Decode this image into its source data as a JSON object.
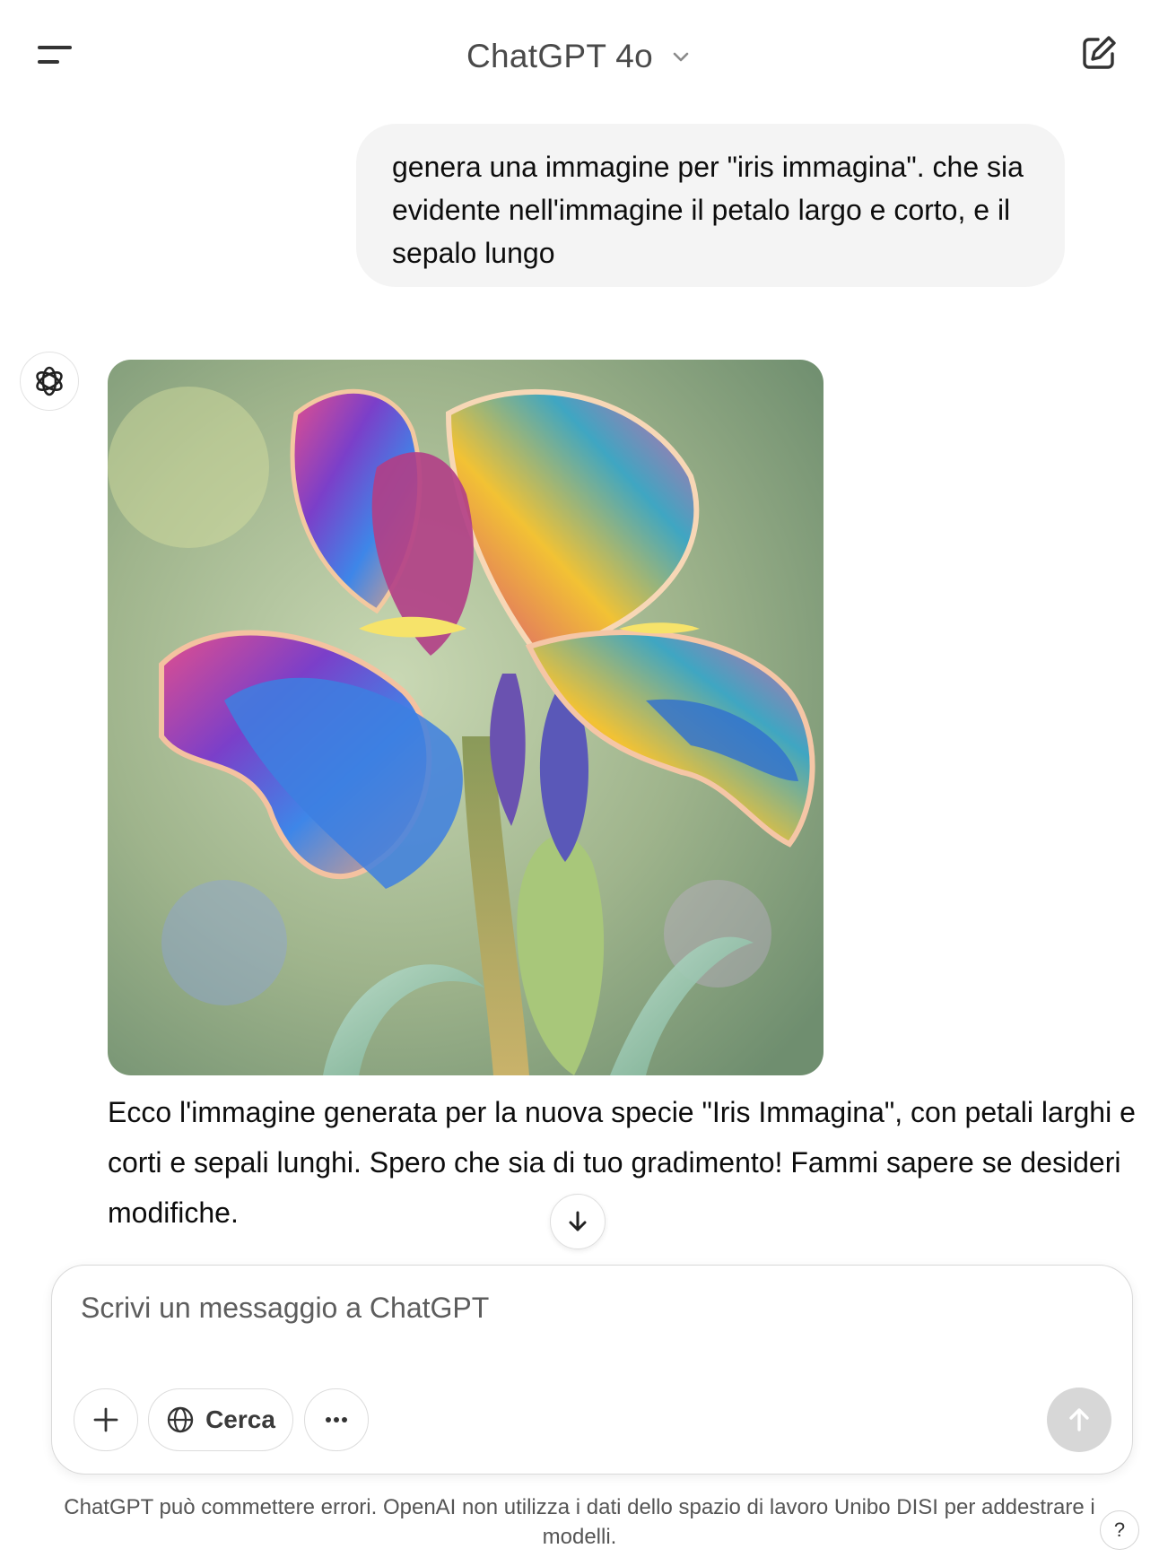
{
  "header": {
    "title": "ChatGPT 4o",
    "menu_icon": "sidebar-menu-icon",
    "compose_icon": "new-chat-compose-icon"
  },
  "conversation": {
    "user_message": "genera una immagine per \"iris immagina\". che sia evidente nell'immagine il petalo largo e corto, e il sepalo lungo",
    "assistant_avatar_icon": "openai-logo-icon",
    "assistant_image_icon": "generated-iris-image",
    "assistant_message": "Ecco l'immagine generata per la nuova specie \"Iris Immagina\", con petali larghi e corti e sepali lunghi. Spero che sia di tuo gradimento! Fammi sapere se desideri modifiche."
  },
  "composer": {
    "placeholder": "Scrivi un messaggio a ChatGPT",
    "search_label": "Cerca",
    "attach_icon": "plus-icon",
    "search_icon": "globe-icon",
    "more_icon": "ellipsis-icon",
    "send_icon": "arrow-up-icon",
    "send_enabled": false
  },
  "footer": {
    "disclaimer": "ChatGPT può commettere errori. OpenAI non utilizza i dati dello spazio di lavoro Unibo DISI per addestrare i modelli.",
    "help_label": "?"
  },
  "colors": {
    "user_bubble": "#f4f4f4",
    "text": "#0d0d0d",
    "send_disabled": "#d7d7d7"
  }
}
